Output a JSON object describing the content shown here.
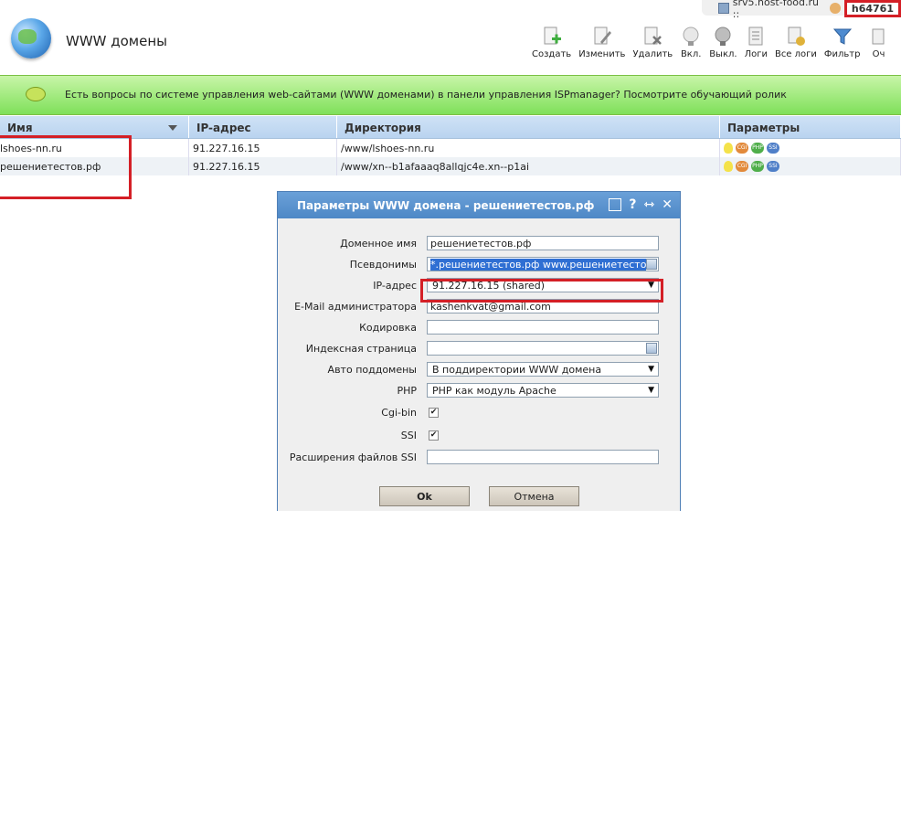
{
  "top": {
    "server": "srv5.host-food.ru ::",
    "user": "h64761"
  },
  "header": {
    "title": "WWW домены"
  },
  "toolbar": [
    {
      "label": "Создать",
      "icon": "create-icon"
    },
    {
      "label": "Изменить",
      "icon": "edit-icon"
    },
    {
      "label": "Удалить",
      "icon": "delete-icon"
    },
    {
      "label": "Вкл.",
      "icon": "bulb-on-icon"
    },
    {
      "label": "Выкл.",
      "icon": "bulb-off-icon"
    },
    {
      "label": "Логи",
      "icon": "logs-icon"
    },
    {
      "label": "Все логи",
      "icon": "all-logs-icon"
    },
    {
      "label": "Фильтр",
      "icon": "filter-icon"
    },
    {
      "label": "Оч",
      "icon": "clear-icon"
    }
  ],
  "banner": {
    "text": "Есть вопросы по системе управления web-сайтами (WWW доменами) в панели управления ISPmanager? Посмотрите обучающий ролик"
  },
  "table": {
    "headers": [
      "Имя",
      "IP-адрес",
      "Директория",
      "Параметры"
    ],
    "rows": [
      {
        "name": "lshoes-nn.ru",
        "ip": "91.227.16.15",
        "dir": "/www/lshoes-nn.ru"
      },
      {
        "name": "решениетестов.рф",
        "ip": "91.227.16.15",
        "dir": "/www/xn--b1afaaaq8allqjc4e.xn--p1ai"
      }
    ],
    "param_badges": [
      "CGI",
      "PHP",
      "SSI"
    ]
  },
  "dialog": {
    "title": "Параметры WWW домена - решениетестов.рф",
    "fields": {
      "domain_label": "Доменное имя",
      "domain_value": "решениетестов.рф",
      "aliases_label": "Псевдонимы",
      "aliases_value": "*.решениетестов.рф www.решениетесто",
      "ip_label": "IP-адрес",
      "ip_value": "91.227.16.15 (shared)",
      "email_label": "E-Mail администратора",
      "email_value": "kashenkvat@gmail.com",
      "encoding_label": "Кодировка",
      "encoding_value": "",
      "index_label": "Индексная страница",
      "index_value": "",
      "autosub_label": "Авто поддомены",
      "autosub_value": "В поддиректории WWW домена",
      "php_label": "PHP",
      "php_value": "PHP как модуль Apache",
      "cgi_label": "Cgi-bin",
      "cgi_checked": true,
      "ssi_label": "SSI",
      "ssi_checked": true,
      "ssiext_label": "Расширения файлов SSI",
      "ssiext_value": ""
    },
    "ok_label": "Ok",
    "cancel_label": "Отмена"
  },
  "colors": {
    "accent": "#4e88c6",
    "highlight": "#d41f26",
    "banner": "#7fe05a"
  }
}
